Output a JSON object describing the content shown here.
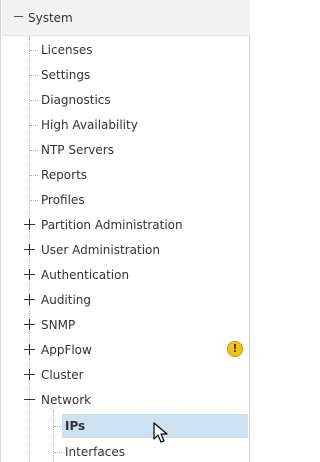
{
  "tree": {
    "root": {
      "label": "System"
    },
    "items": [
      {
        "label": "Licenses",
        "type": "leaf"
      },
      {
        "label": "Settings",
        "type": "leaf"
      },
      {
        "label": "Diagnostics",
        "type": "leaf"
      },
      {
        "label": "High Availability",
        "type": "leaf"
      },
      {
        "label": "NTP Servers",
        "type": "leaf"
      },
      {
        "label": "Reports",
        "type": "leaf"
      },
      {
        "label": "Profiles",
        "type": "leaf"
      },
      {
        "label": "Partition Administration",
        "type": "collapsed"
      },
      {
        "label": "User Administration",
        "type": "collapsed"
      },
      {
        "label": "Authentication",
        "type": "collapsed"
      },
      {
        "label": "Auditing",
        "type": "collapsed"
      },
      {
        "label": "SNMP",
        "type": "collapsed"
      },
      {
        "label": "AppFlow",
        "type": "collapsed",
        "warning": "!"
      },
      {
        "label": "Cluster",
        "type": "collapsed"
      },
      {
        "label": "Network",
        "type": "expanded",
        "children": [
          {
            "label": "IPs",
            "selected": true
          },
          {
            "label": "Interfaces"
          }
        ]
      }
    ]
  },
  "colors": {
    "selected_bg": "#cde1f0",
    "warning": "#f6c21a"
  },
  "icons": {
    "root_toggle": "minus-icon",
    "collapsed_toggle": "plus-icon",
    "expanded_toggle": "minus-icon",
    "warning": "warning-icon",
    "cursor": "mouse-pointer-icon"
  }
}
